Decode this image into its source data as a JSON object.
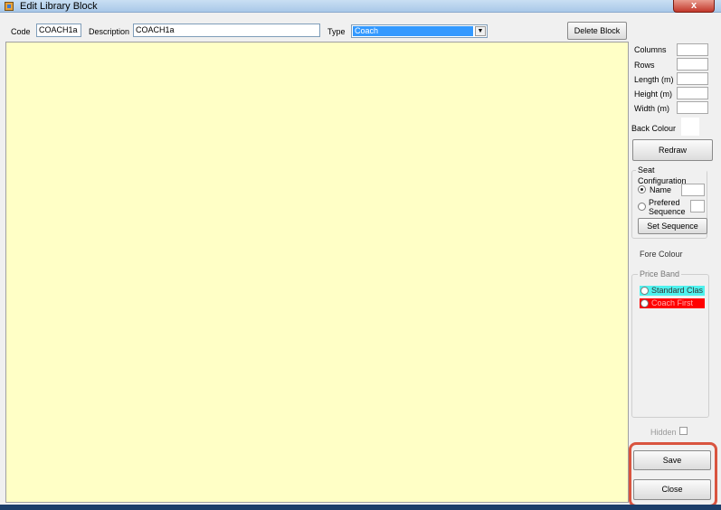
{
  "window": {
    "title": "Edit Library Block",
    "close_symbol": "x"
  },
  "toolbar": {
    "code_label": "Code",
    "code_value": "COACH1a",
    "description_label": "Description",
    "description_value": "COACH1a",
    "type_label": "Type",
    "type_value": "Coach",
    "delete_button": "Delete Block"
  },
  "dimensions": {
    "columns_label": "Columns",
    "rows_label": "Rows",
    "length_label": "Length (m)",
    "height_label": "Height (m)",
    "width_label": "Width (m)",
    "back_colour_label": "Back Colour",
    "redraw_button": "Redraw"
  },
  "seat_configuration": {
    "title": "Seat Configuration",
    "name_label": "Name",
    "sequence_label_1": "Prefered",
    "sequence_label_2": "Sequence",
    "set_sequence_button": "Set Sequence"
  },
  "fore_colour_label": "Fore Colour",
  "price_band": {
    "title": "Price Band",
    "items": [
      {
        "label": "Standard Clas",
        "color": "#4ff2ee"
      },
      {
        "label": "Coach First",
        "color": "#ff0000"
      }
    ]
  },
  "hidden_label": "Hidden",
  "save_button": "Save",
  "close_button": "Close",
  "colors": {
    "canvas_background": "#ffffc6",
    "selection": "#3399ff",
    "highlight_border": "#d9543f"
  }
}
